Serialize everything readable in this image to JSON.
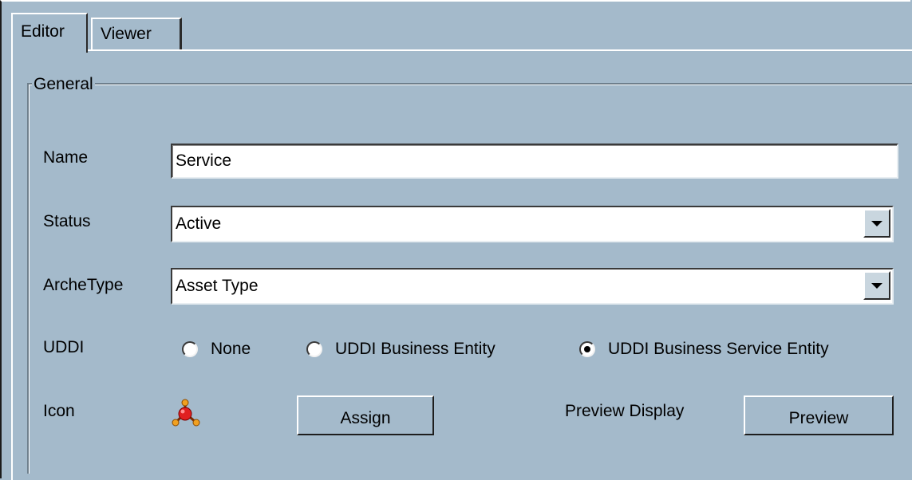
{
  "tabs": [
    {
      "label": "Editor",
      "active": true
    },
    {
      "label": "Viewer",
      "active": false
    }
  ],
  "group": {
    "title": "General"
  },
  "fields": {
    "name": {
      "label": "Name",
      "value": "Service"
    },
    "status": {
      "label": "Status",
      "value": "Active"
    },
    "archetype": {
      "label": "ArcheType",
      "value": "Asset Type"
    }
  },
  "uddi": {
    "label": "UDDI",
    "options": [
      {
        "label": "None",
        "checked": false
      },
      {
        "label": "UDDI Business Entity",
        "checked": false
      },
      {
        "label": "UDDI Business Service Entity",
        "checked": true
      }
    ]
  },
  "icon_row": {
    "label": "Icon",
    "icon": "molecule-icon",
    "assign_label": "Assign",
    "preview_display_label": "Preview Display",
    "preview_label": "Preview"
  },
  "colors": {
    "background": "#a4bacb",
    "icon_red": "#e02020",
    "icon_orange": "#f0a020"
  }
}
